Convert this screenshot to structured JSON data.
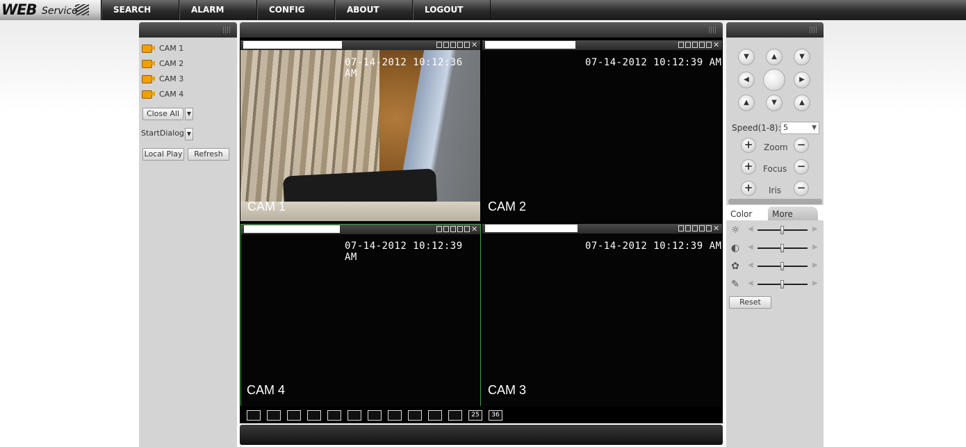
{
  "logo": {
    "main": "WEB",
    "sub": "Service"
  },
  "nav": [
    {
      "label": "SEARCH"
    },
    {
      "label": "ALARM"
    },
    {
      "label": "CONFIG"
    },
    {
      "label": "ABOUT"
    },
    {
      "label": "LOGOUT"
    }
  ],
  "cameras": [
    "CAM 1",
    "CAM 2",
    "CAM 3",
    "CAM 4"
  ],
  "left_controls": {
    "close_all": "Close All",
    "start_dialog": "StartDialog",
    "local_play": "Local Play",
    "refresh": "Refresh"
  },
  "videos": [
    {
      "label": "CAM 1",
      "timestamp": "07-14-2012 10:12:36 AM"
    },
    {
      "label": "CAM 2",
      "timestamp": "07-14-2012 10:12:39 AM"
    },
    {
      "label": "CAM 4",
      "timestamp": "07-14-2012 10:12:39 AM"
    },
    {
      "label": "CAM 3",
      "timestamp": "07-14-2012 10:12:39 AM"
    }
  ],
  "layout_buttons": [
    "",
    "",
    "",
    "",
    "",
    "",
    "",
    "",
    "",
    "",
    "",
    "25",
    "36"
  ],
  "ptz": {
    "speed_label": "Speed(1-8):",
    "speed_value": "5",
    "zoom": "Zoom",
    "focus": "Focus",
    "iris": "Iris"
  },
  "color_panel": {
    "tab_color": "Color",
    "tab_more": "More",
    "sliders": [
      {
        "icon": "brightness-icon",
        "value": 0.5
      },
      {
        "icon": "contrast-icon",
        "value": 0.5
      },
      {
        "icon": "saturation-icon",
        "value": 0.5
      },
      {
        "icon": "hue-icon",
        "value": 0.5
      }
    ],
    "reset": "Reset"
  },
  "colors": {
    "accent_green": "#3aa83a",
    "cam_icon": "#f0a000"
  }
}
